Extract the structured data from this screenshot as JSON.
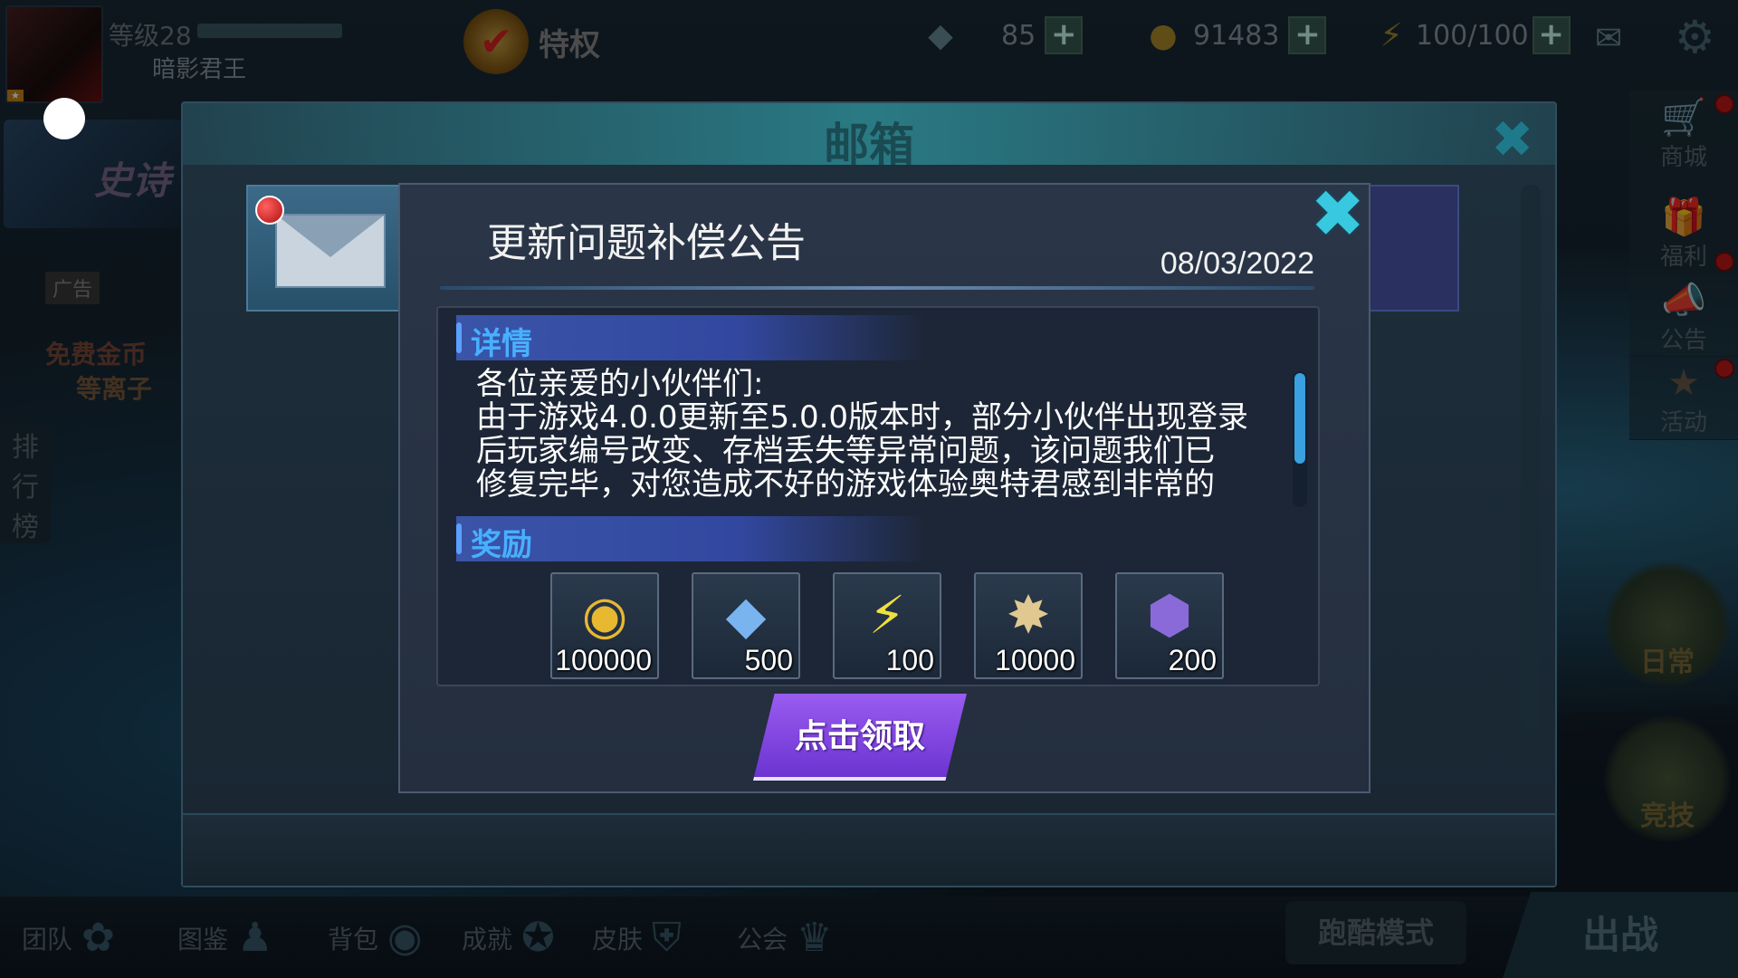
{
  "header": {
    "level_label": "等级28",
    "player_name": "暗影君王",
    "privilege_label": "特权",
    "gems": "85",
    "coins": "91483",
    "energy": "100/100"
  },
  "left": {
    "banner_text": "史诗",
    "ad_tag": "广告",
    "ad_line1": "免费金币",
    "ad_line2": "等离子",
    "rank_label": [
      "排",
      "行",
      "榜"
    ]
  },
  "side_menu": {
    "shop": "商城",
    "welfare": "福利",
    "notice": "公告",
    "activity": "活动",
    "daily": "日常",
    "arena": "竞技"
  },
  "bottom_nav": {
    "team": "团队",
    "catalog": "图鉴",
    "bag": "背包",
    "achievement": "成就",
    "skin": "皮肤",
    "guild": "公会",
    "parkour": "跑酷模式",
    "fight": "出战"
  },
  "mailbox": {
    "title": "邮箱"
  },
  "mail": {
    "title": "更新问题补偿公告",
    "date": "08/03/2022",
    "details_header": "详情",
    "body_lines": [
      "各位亲爱的小伙伴们:",
      "由于游戏4.0.0更新至5.0.0版本时，部分小伙伴出现登录",
      "后玩家编号改变、存档丢失等异常问题，该问题我们已",
      "修复完毕，对您造成不好的游戏体验奥特君感到非常的"
    ],
    "rewards_header": "奖励",
    "rewards": [
      {
        "icon": "gold-coins-icon",
        "value": "100000"
      },
      {
        "icon": "diamonds-icon",
        "value": "500"
      },
      {
        "icon": "lightning-icon",
        "value": "100"
      },
      {
        "icon": "light-orb-icon",
        "value": "10000"
      },
      {
        "icon": "purple-crystal-icon",
        "value": "200"
      }
    ],
    "claim_label": "点击领取"
  }
}
